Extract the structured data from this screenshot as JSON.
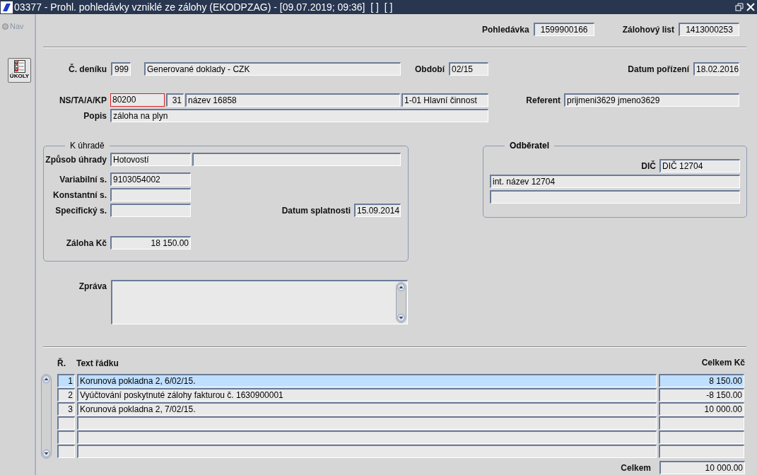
{
  "window": {
    "title": "03377 - Prohl. pohledávky vzniklé ze zálohy (EKODPZAG) - [09.07.2019; 09:36]  [ ]  [ ]"
  },
  "nav": {
    "label": "Nav",
    "selected": false
  },
  "tasks_button": {
    "label": "ÚKOLY"
  },
  "header_fields": [
    {
      "label": "Pohledávka",
      "value": "1599900166"
    },
    {
      "label": "Zálohový list",
      "value": "1413000253"
    }
  ],
  "journal": {
    "label": "Č. deníku",
    "number": "999",
    "name": "Generované doklady - CZK"
  },
  "period": {
    "label": "Období",
    "value": "02/15"
  },
  "created": {
    "label": "Datum pořízení",
    "value": "18.02.2016"
  },
  "account": {
    "label": "NS/TA/A/KP",
    "ns": "80200",
    "invalid": true,
    "ta": "31",
    "name": "název 16858",
    "activity": "1-01 Hlavní činnost"
  },
  "referent": {
    "label": "Referent",
    "value": "prijmeni3629 jmeno3629"
  },
  "description": {
    "label": "Popis",
    "value": "záloha na plyn"
  },
  "payment": {
    "title": "K úhradě",
    "method": {
      "label": "Způsob úhrady",
      "value": "Hotovostí"
    },
    "variable": {
      "label": "Variabilní s.",
      "value": "9103054002"
    },
    "constant": {
      "label": "Konstantní s."
    },
    "specific": {
      "label": "Specifický s."
    },
    "due": {
      "label": "Datum splatnosti",
      "value": "15.09.2014"
    },
    "advance": {
      "label": "Záloha Kč",
      "value": "18 150.00"
    }
  },
  "customer": {
    "title": "Odběratel",
    "dic": {
      "label": "DIČ",
      "value": "DIČ 12704"
    },
    "name": "int. název 12704"
  },
  "message": {
    "label": "Zpráva"
  },
  "lines": {
    "columns": [
      "Ř.",
      "Text řádku",
      "Celkem Kč"
    ],
    "rows": [
      {
        "number": "1",
        "text": "Korunová pokladna 2, 6/02/15.",
        "amount": "8 150.00",
        "selected": true
      },
      {
        "number": "2",
        "text": "Vyúčtování poskytnuté zálohy fakturou č. 1630900001",
        "amount": "-8 150.00",
        "selected": false
      },
      {
        "number": "3",
        "text": "Korunová pokladna 2, 7/02/15.",
        "amount": "10 000.00",
        "selected": false
      },
      {
        "selected": false
      },
      {
        "selected": false
      },
      {
        "selected": false
      }
    ]
  },
  "total": {
    "label": "Celkem",
    "value": "10 000.00"
  }
}
